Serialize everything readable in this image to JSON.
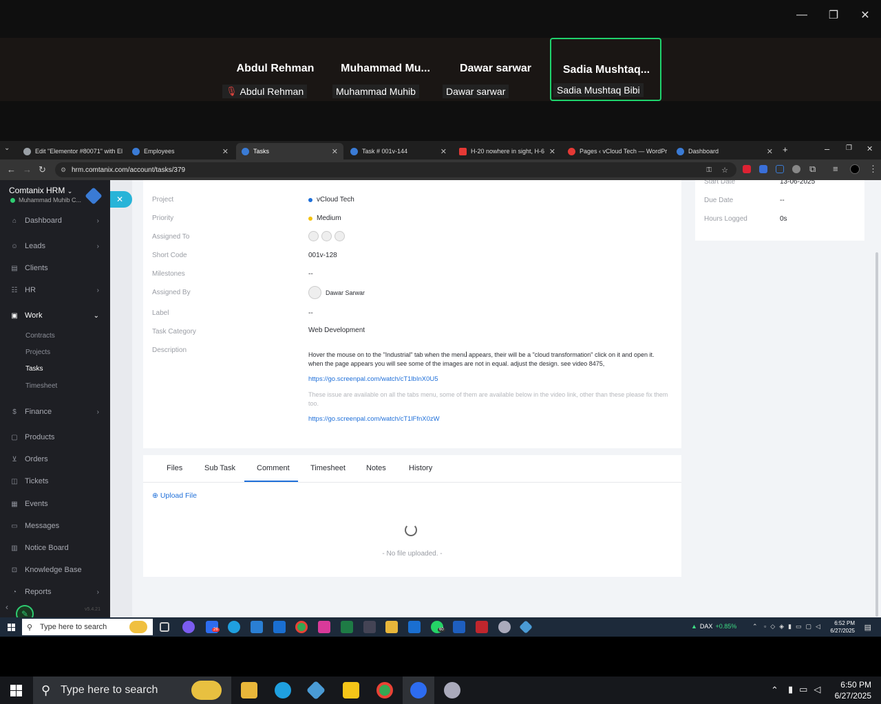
{
  "zoom": {
    "participants": [
      {
        "big": "Abdul Rehman",
        "small": "Abdul Rehman",
        "muted": true,
        "active": false
      },
      {
        "big": "Muhammad  Mu...",
        "small": "Muhammad Muhib",
        "muted": false,
        "active": false
      },
      {
        "big": "Dawar sarwar",
        "small": "Dawar sarwar",
        "muted": false,
        "active": false
      },
      {
        "big": "Sadia  Mushtaq...",
        "small": "Sadia Mushtaq Bibi",
        "muted": false,
        "active": true
      }
    ]
  },
  "browser": {
    "tabs": [
      {
        "label": "Edit \"Elementor #80071\" with El",
        "color": "#9aa0a6"
      },
      {
        "label": "Employees",
        "color": "#3a7bd5"
      },
      {
        "label": "Tasks",
        "color": "#3a7bd5"
      },
      {
        "label": "Task # 001v-144",
        "color": "#3a7bd5"
      },
      {
        "label": "H-20 nowhere in sight, H-6",
        "color": "#e53935"
      },
      {
        "label": "Pages ‹ vCloud Tech — WordPr",
        "color": "#e53935"
      },
      {
        "label": "Dashboard",
        "color": "#3a7bd5"
      }
    ],
    "url": "hrm.comtanix.com/account/tasks/379"
  },
  "sidebar": {
    "brand": "Comtanix HRM",
    "user": "Muhammad Muhib C...",
    "items": [
      {
        "label": "Dashboard",
        "icon": "home-icon",
        "glyph": "⌂",
        "chevron": true
      },
      {
        "label": "Leads",
        "icon": "user-icon",
        "glyph": "☺",
        "chevron": true
      },
      {
        "label": "Clients",
        "icon": "clients-icon",
        "glyph": "▤",
        "chevron": false
      },
      {
        "label": "HR",
        "icon": "hr-icon",
        "glyph": "☷",
        "chevron": true
      },
      {
        "label": "Work",
        "icon": "briefcase-icon",
        "glyph": "▣",
        "chevron": true
      },
      {
        "label": "Finance",
        "icon": "dollar-icon",
        "glyph": "$",
        "chevron": true
      },
      {
        "label": "Products",
        "icon": "box-icon",
        "glyph": "▢",
        "chevron": false
      },
      {
        "label": "Orders",
        "icon": "cart-icon",
        "glyph": "⊻",
        "chevron": false
      },
      {
        "label": "Tickets",
        "icon": "ticket-icon",
        "glyph": "◫",
        "chevron": false
      },
      {
        "label": "Events",
        "icon": "calendar-icon",
        "glyph": "▦",
        "chevron": false
      },
      {
        "label": "Messages",
        "icon": "chat-icon",
        "glyph": "▭",
        "chevron": false
      },
      {
        "label": "Notice Board",
        "icon": "notice-icon",
        "glyph": "▥",
        "chevron": false
      },
      {
        "label": "Knowledge Base",
        "icon": "book-icon",
        "glyph": "⊡",
        "chevron": false
      },
      {
        "label": "Reports",
        "icon": "chart-icon",
        "glyph": "◔",
        "chevron": true
      }
    ],
    "work_sub": [
      "Contracts",
      "Projects",
      "Tasks",
      "Timesheet"
    ],
    "version": "v5.4.21"
  },
  "task": {
    "fields": [
      {
        "label": "Project",
        "value": "vCloud Tech",
        "dot": "#1e6fd9"
      },
      {
        "label": "Priority",
        "value": "Medium",
        "dot": "#f4c20d"
      },
      {
        "label": "Assigned To",
        "value": "",
        "dot": ""
      },
      {
        "label": "Short Code",
        "value": "001v-128",
        "dot": ""
      },
      {
        "label": "Milestones",
        "value": "--",
        "dot": ""
      },
      {
        "label": "Assigned By",
        "value": "Dawar Sarwar",
        "dot": ""
      },
      {
        "label": "Label",
        "value": "--",
        "dot": ""
      },
      {
        "label": "Task Category",
        "value": "Web Development",
        "dot": ""
      },
      {
        "label": "Description",
        "value": "",
        "dot": ""
      }
    ],
    "description": "Hover the mouse on to the \"Industrial\" tab when the menu appears, their will be a \"cloud transformation\" click on it and open it. when the page appears you will see some of the images are not in equal. adjust the design. see video 8475,",
    "link1": "https://go.screenpal.com/watch/cT1lbInX0U5",
    "muted_note": "These issue are available on all the tabs menu, some of them are available below in the video link, other than these please fix them too.",
    "link2": "https://go.screenpal.com/watch/cT1lFfnX0zW"
  },
  "tabs": [
    "Files",
    "Sub Task",
    "Comment",
    "Timesheet",
    "Notes",
    "History"
  ],
  "upload_label": "Upload File",
  "no_file": "- No file uploaded. -",
  "right_panel": {
    "start_label": "Start Date",
    "start_value": "13-06-2025",
    "due_label": "Due Date",
    "due_value": "--",
    "hours_label": "Hours Logged",
    "hours_value": "0s"
  },
  "inner_taskbar": {
    "search": "Type here to search",
    "dax_label": "DAX",
    "dax_change": "+0.85%",
    "time": "6:52 PM",
    "date": "6/27/2025",
    "badge": "60"
  },
  "outer_taskbar": {
    "search": "Type here to search",
    "time": "6:50 PM",
    "date": "6/27/2025"
  }
}
